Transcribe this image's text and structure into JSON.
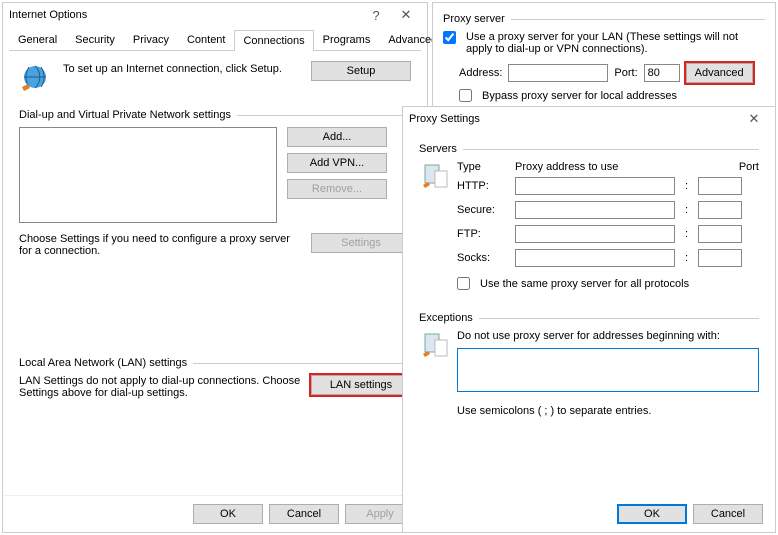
{
  "internet_options": {
    "title": "Internet Options",
    "tabs": [
      "General",
      "Security",
      "Privacy",
      "Content",
      "Connections",
      "Programs",
      "Advanced"
    ],
    "active_tab": "Connections",
    "setup_text": "To set up an Internet connection, click Setup.",
    "setup_btn": "Setup",
    "dialup_group": "Dial-up and Virtual Private Network settings",
    "add_btn": "Add...",
    "add_vpn_btn": "Add VPN...",
    "remove_btn": "Remove...",
    "settings_btn": "Settings",
    "choose_settings": "Choose Settings if you need to configure a proxy server for a connection.",
    "lan_group": "Local Area Network (LAN) settings",
    "lan_note": "LAN Settings do not apply to dial-up connections. Choose Settings above for dial-up settings.",
    "lan_btn": "LAN settings",
    "ok": "OK",
    "cancel": "Cancel",
    "apply": "Apply"
  },
  "proxy_server": {
    "group": "Proxy server",
    "use_proxy": "Use a proxy server for your LAN (These settings will not apply to dial-up or VPN connections).",
    "use_proxy_checked": true,
    "address_label": "Address:",
    "address_value": "",
    "port_label": "Port:",
    "port_value": "80",
    "advanced_btn": "Advanced",
    "bypass_label": "Bypass proxy server for local addresses",
    "bypass_checked": false
  },
  "proxy_settings": {
    "title": "Proxy Settings",
    "servers_group": "Servers",
    "type_hdr": "Type",
    "addr_hdr": "Proxy address to use",
    "port_hdr": "Port",
    "rows": [
      {
        "label": "HTTP:",
        "addr": "",
        "port": ""
      },
      {
        "label": "Secure:",
        "addr": "",
        "port": ""
      },
      {
        "label": "FTP:",
        "addr": "",
        "port": ""
      },
      {
        "label": "Socks:",
        "addr": "",
        "port": ""
      }
    ],
    "same_label": "Use the same proxy server for all protocols",
    "same_checked": false,
    "exceptions_group": "Exceptions",
    "exceptions_note": "Do not use proxy server for addresses beginning with:",
    "exceptions_value": "",
    "semicolon_note": "Use semicolons ( ; ) to separate entries.",
    "ok": "OK",
    "cancel": "Cancel"
  }
}
